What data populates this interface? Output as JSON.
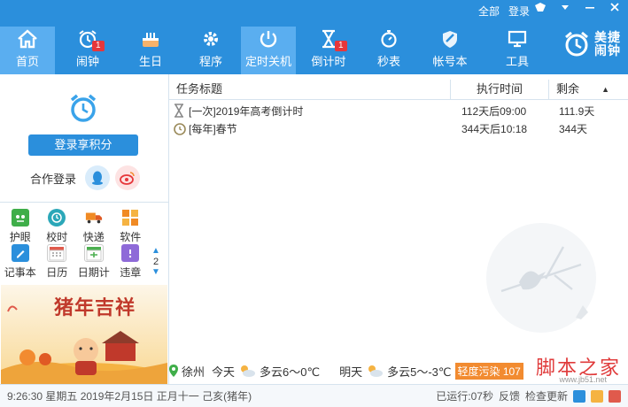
{
  "toplinks": {
    "all": "全部",
    "login": "登录"
  },
  "nav": [
    {
      "label": "首页",
      "icon": "home-icon",
      "badge": ""
    },
    {
      "label": "闹钟",
      "icon": "alarm-icon",
      "badge": "1"
    },
    {
      "label": "生日",
      "icon": "cake-icon",
      "badge": ""
    },
    {
      "label": "程序",
      "icon": "gear-icon",
      "badge": ""
    },
    {
      "label": "定时关机",
      "icon": "power-icon",
      "badge": ""
    },
    {
      "label": "倒计时",
      "icon": "hourglass-icon",
      "badge": "1"
    },
    {
      "label": "秒表",
      "icon": "stopwatch-icon",
      "badge": ""
    },
    {
      "label": "帐号本",
      "icon": "shield-icon",
      "badge": ""
    },
    {
      "label": "工具",
      "icon": "monitor-icon",
      "badge": ""
    }
  ],
  "logo": {
    "line1": "美捷",
    "line2": "闹钟"
  },
  "left": {
    "login_button": "登录享积分",
    "coop_label": "合作登录",
    "grid": [
      [
        "护眼",
        "校时",
        "快递",
        "软件"
      ],
      [
        "记事本",
        "日历",
        "日期计",
        "违章"
      ]
    ],
    "grid_colors": [
      [
        "#3fae49",
        "#2ba7b8",
        "#f08a24",
        "#f08a24"
      ],
      [
        "#2b8fdc",
        "#e05a4c",
        "#4caf50",
        "#8e6ad8"
      ]
    ],
    "page_num": "2",
    "banner_text": "猪年吉祥"
  },
  "table": {
    "headers": [
      "任务标题",
      "执行时间",
      "剩余"
    ],
    "rows": [
      {
        "title": "[一次]2019年高考倒计时",
        "time": "112天后09:00",
        "remain": "111.9天",
        "icon": "hourglass-icon"
      },
      {
        "title": "[每年]春节",
        "time": "344天后10:18",
        "remain": "344天",
        "icon": "alarm-icon"
      }
    ]
  },
  "weather": {
    "city": "徐州",
    "today_label": "今天",
    "today": "多云6～0℃",
    "tomorrow_label": "明天",
    "tomorrow": "多云5～-3℃",
    "aqi": "轻度污染 107"
  },
  "status": {
    "datetime": "9:26:30 星期五 2019年2月15日 正月十一 己亥(猪年)",
    "runtime": "已运行:07秒",
    "feedback": "反馈",
    "update": "检查更新"
  },
  "watermark": {
    "text": "脚本之家",
    "url": "www.jb51.net"
  },
  "colors": {
    "brand": "#2b8fdc",
    "badge": "#e6373b",
    "aqi": "#f28b30"
  }
}
